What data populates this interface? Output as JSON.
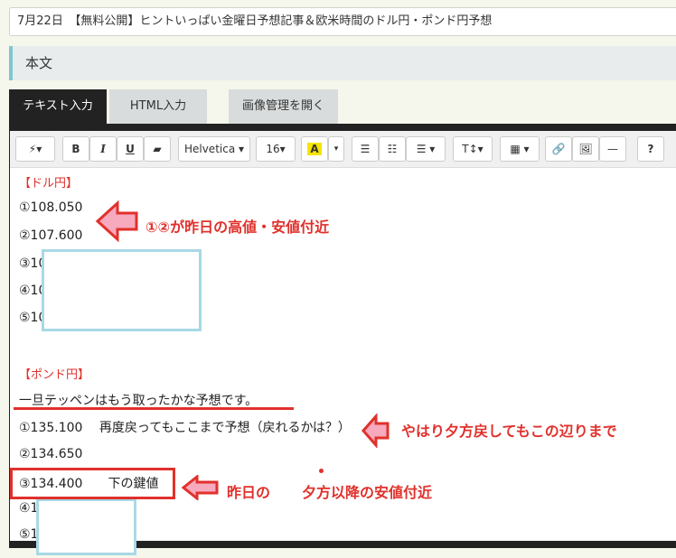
{
  "title_input": "7月22日　【無料公開】ヒントいっぱい金曜日予想記事＆欧米時間のドル円・ポンド円予想",
  "section_heading": "本文",
  "tabs": {
    "text_input": "テキスト入力",
    "html_input": "HTML入力",
    "image_manager": "画像管理を開く"
  },
  "toolbar": {
    "magic": "⚡▾",
    "bold": "B",
    "italic": "I",
    "underline": "U",
    "eraser": "▰",
    "font_family": "Helvetica ▾",
    "font_size": "16▾",
    "color": "A",
    "color_caret": "▾",
    "ul": "☰",
    "ol": "☷",
    "align": "☰ ▾",
    "height": "T↕▾",
    "table": "▦ ▾",
    "link": "🔗",
    "image": "🖼",
    "hr": "—",
    "help": "?"
  },
  "content": {
    "dollar_header": "【ドル円】",
    "d1": "①108.050",
    "d2": "②107.600",
    "d3": "③10",
    "d4": "④10",
    "d5": "⑤10",
    "pound_header": "【ポンド円】",
    "pound_note": "一旦テッペンはもう取ったかな予想です。",
    "p1": "①135.100　 再度戻ってもここまで予想（戻れるかは？）",
    "p2": "②134.650",
    "p3": "③134.400　　下の鍵値",
    "p4": "④1",
    "p5": "⑤1"
  },
  "annotations": {
    "a1": "①②が昨日の高値・安値付近",
    "a2": "やはり夕方戻してもこの辺りまで",
    "a3_part1": "昨日の",
    "a3_part2": "夕方以降の安値付近"
  },
  "colors": {
    "annotation_red": "#e0312c",
    "arrow_fill": "#f7a9bd",
    "mask_border": "#a9d8e6"
  }
}
